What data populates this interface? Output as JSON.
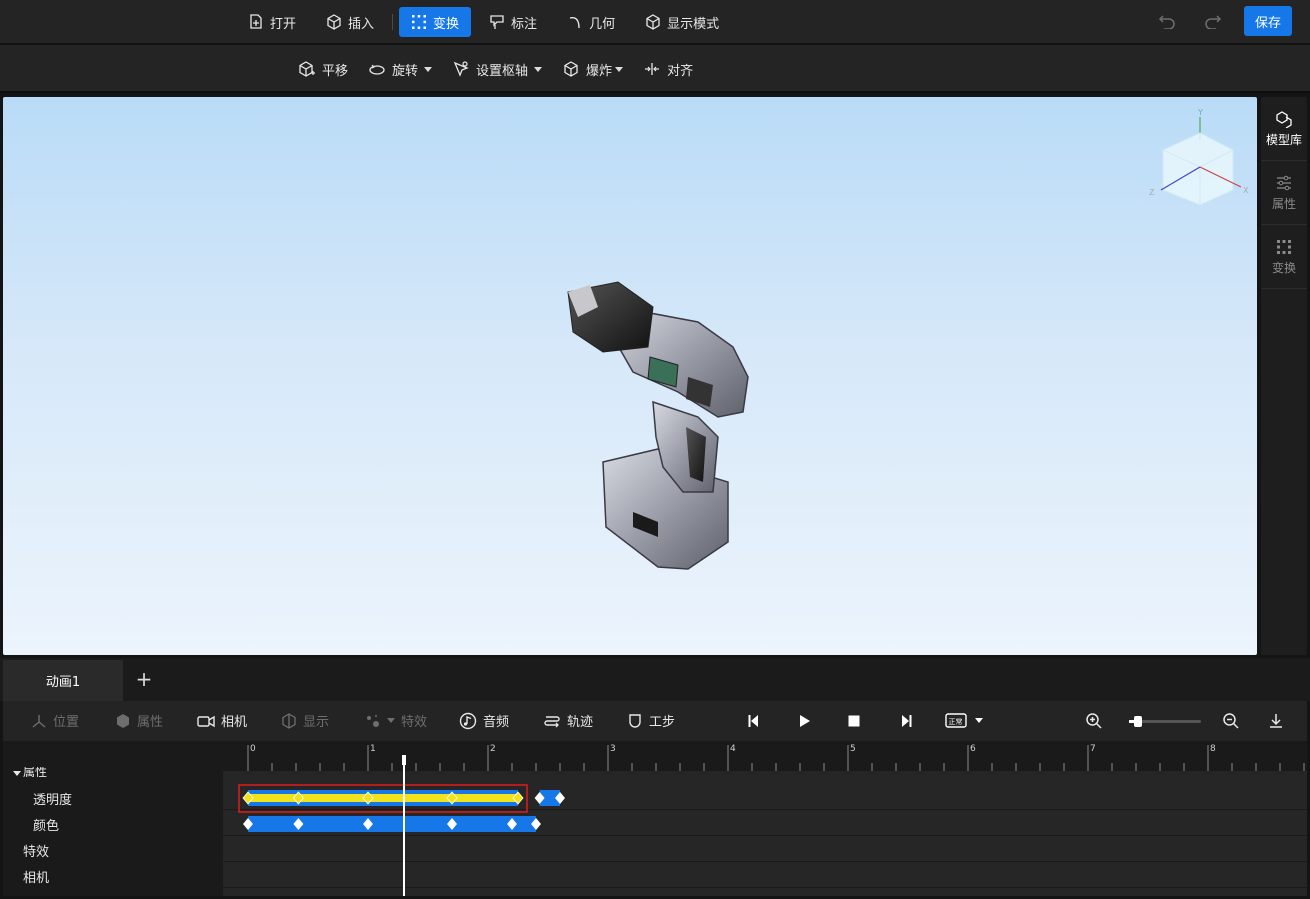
{
  "toolbar": {
    "open": "打开",
    "insert": "插入",
    "transform": "变换",
    "annotate": "标注",
    "geometry": "几何",
    "display_mode": "显示模式",
    "save": "保存"
  },
  "subtoolbar": {
    "translate": "平移",
    "rotate": "旋转",
    "set_pivot": "设置枢轴",
    "explode": "爆炸",
    "align": "对齐"
  },
  "right_sidebar": {
    "model_library": "模型库",
    "properties": "属性",
    "transform": "变换"
  },
  "viewcube": {
    "y": "Y",
    "x": "X",
    "z": "Z"
  },
  "animation": {
    "tab": "动画1",
    "add_tab": "+",
    "tools": {
      "position": "位置",
      "properties": "属性",
      "camera": "相机",
      "display": "显示",
      "effects": "特效",
      "audio": "音频",
      "trajectory": "轨迹",
      "step": "工步"
    },
    "speed_badge": "正常",
    "zoom_level": 0.07
  },
  "timeline": {
    "ruler_labels": [
      "0",
      "1",
      "2",
      "3",
      "4",
      "5",
      "6",
      "7",
      "8"
    ],
    "playhead_time": 1.3,
    "group_label": "属性",
    "tracks": [
      {
        "name": "透明度",
        "keyframes": [
          0,
          0.42,
          1.0,
          1.7,
          2.25,
          2.43,
          2.6
        ],
        "selected_range": [
          0,
          2.25
        ]
      },
      {
        "name": "颜色",
        "keyframes": [
          0,
          0.42,
          1.0,
          1.7,
          2.2,
          2.4
        ]
      },
      {
        "name": "特效",
        "keyframes": []
      },
      {
        "name": "相机",
        "keyframes": []
      }
    ]
  }
}
